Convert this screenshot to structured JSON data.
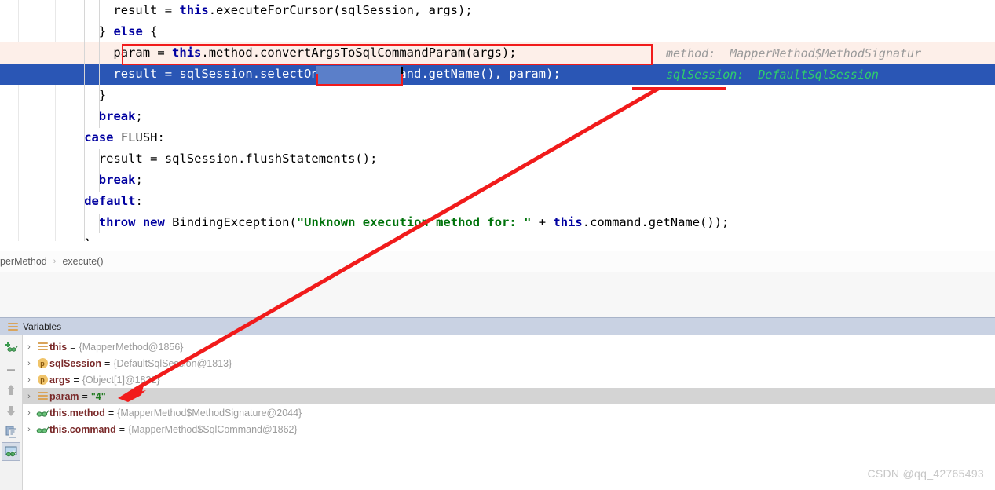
{
  "editor": {
    "lines": [
      {
        "indent": 8,
        "state": "normal",
        "tokens": [
          {
            "t": "result = ",
            "c": "p"
          },
          {
            "t": "this",
            "c": "k"
          },
          {
            "t": ".executeForCursor(sqlSession, args);",
            "c": "p"
          }
        ]
      },
      {
        "indent": 6,
        "state": "normal",
        "tokens": [
          {
            "t": "} ",
            "c": "p"
          },
          {
            "t": "else",
            "c": "k"
          },
          {
            "t": " {",
            "c": "p"
          }
        ]
      },
      {
        "indent": 8,
        "state": "exec",
        "tokens": [
          {
            "t": "param = ",
            "c": "p"
          },
          {
            "t": "this",
            "c": "k"
          },
          {
            "t": ".method.convertArgsToSqlCommandParam(args);",
            "c": "p"
          }
        ],
        "hint": "method:  MapperMethod$MethodSignatur"
      },
      {
        "indent": 8,
        "state": "selected",
        "tokens": [
          {
            "t": "result = sqlSession.selectOne(",
            "c": "wp"
          },
          {
            "t": "this",
            "c": "wk"
          },
          {
            "t": ".command.getName(), param);",
            "c": "wp"
          }
        ],
        "hint": "sqlSession:  DefaultSqlSession"
      },
      {
        "indent": 6,
        "state": "normal",
        "tokens": [
          {
            "t": "}",
            "c": "p"
          }
        ]
      },
      {
        "indent": 6,
        "state": "normal",
        "tokens": [
          {
            "t": "break",
            "c": "k"
          },
          {
            "t": ";",
            "c": "p"
          }
        ]
      },
      {
        "indent": 4,
        "state": "normal",
        "tokens": [
          {
            "t": "case",
            "c": "k"
          },
          {
            "t": " FLUSH:",
            "c": "p"
          }
        ]
      },
      {
        "indent": 6,
        "state": "normal",
        "tokens": [
          {
            "t": "result = sqlSession.flushStatements();",
            "c": "p"
          }
        ]
      },
      {
        "indent": 6,
        "state": "normal",
        "tokens": [
          {
            "t": "break",
            "c": "k"
          },
          {
            "t": ";",
            "c": "p"
          }
        ]
      },
      {
        "indent": 4,
        "state": "normal",
        "tokens": [
          {
            "t": "default",
            "c": "k"
          },
          {
            "t": ":",
            "c": "p"
          }
        ]
      },
      {
        "indent": 6,
        "state": "normal",
        "tokens": [
          {
            "t": "throw",
            "c": "k"
          },
          {
            "t": " ",
            "c": "p"
          },
          {
            "t": "new",
            "c": "k"
          },
          {
            "t": " BindingException(",
            "c": "p"
          },
          {
            "t": "\"Unknown execution method for: \"",
            "c": "s"
          },
          {
            "t": " + ",
            "c": "p"
          },
          {
            "t": "this",
            "c": "k"
          },
          {
            "t": ".command.getName());",
            "c": "p"
          }
        ]
      },
      {
        "indent": 4,
        "state": "normal",
        "tokens": [
          {
            "t": "}",
            "c": "p"
          }
        ]
      }
    ],
    "selection_text": "selectOne"
  },
  "breadcrumb": {
    "items": [
      "perMethod",
      "execute()"
    ],
    "separator": "›"
  },
  "debug": {
    "tab_label": "Variables",
    "tab_icon": "stripes-icon",
    "toolbar": [
      {
        "name": "add-watch-button",
        "icon": "add-watch-icon"
      },
      {
        "name": "remove-watch-button",
        "icon": "minus-icon"
      },
      {
        "name": "move-up-button",
        "icon": "arrow-up-icon"
      },
      {
        "name": "move-down-button",
        "icon": "arrow-down-icon"
      },
      {
        "name": "copy-value-button",
        "icon": "copy-icon"
      },
      {
        "name": "inspect-button",
        "icon": "watch-image-icon",
        "active": true
      }
    ],
    "variables": [
      {
        "chevron": "›",
        "icon": "field-icon",
        "name": "this",
        "eq": "=",
        "value": "{MapperMethod@1856}",
        "value_kind": "ref",
        "highlighted": false
      },
      {
        "chevron": "›",
        "icon": "parameter-icon",
        "name": "sqlSession",
        "eq": "=",
        "value": "{DefaultSqlSession@1813}",
        "value_kind": "ref",
        "highlighted": false
      },
      {
        "chevron": "›",
        "icon": "parameter-icon",
        "name": "args",
        "eq": "=",
        "value": "{Object[1]@1832}",
        "value_kind": "ref",
        "highlighted": false
      },
      {
        "chevron": "›",
        "icon": "field-icon",
        "name": "param",
        "eq": "=",
        "value": "\"4\"",
        "value_kind": "string",
        "highlighted": true
      },
      {
        "chevron": "›",
        "icon": "watch-icon",
        "name": "this.method",
        "eq": "=",
        "value": "{MapperMethod$MethodSignature@2044}",
        "value_kind": "ref",
        "highlighted": false
      },
      {
        "chevron": "›",
        "icon": "watch-icon",
        "name": "this.command",
        "eq": "=",
        "value": "{MapperMethod$SqlCommand@1862}",
        "value_kind": "ref",
        "highlighted": false
      }
    ]
  },
  "annotations": {
    "color": "#f11b1b",
    "boxes": [
      "param-assignment-box",
      "selectone-underline",
      "param-argument-underline"
    ],
    "arrow": "param-to-variable-arrow"
  },
  "watermark": {
    "text": "CSDN @qq_42765493"
  },
  "colors": {
    "selected_line": "#2a56b5",
    "executing_line": "#fdefe9",
    "annotation_red": "#f11b1b",
    "hint_grey": "#9a9a9a",
    "hint_green": "#2fcf6b",
    "string_green": "#00730b",
    "keyword_blue": "#0000a0"
  }
}
